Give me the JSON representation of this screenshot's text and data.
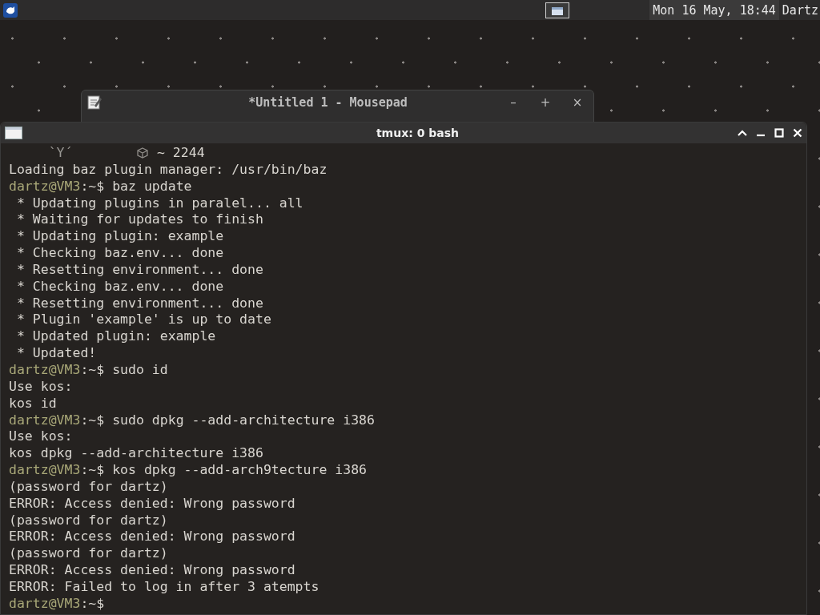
{
  "panel": {
    "clock": "Mon 16 May, 18:44",
    "user": "Dartz"
  },
  "windows": [
    {
      "title": "*Untitled 1 - Mousepad",
      "buttons": [
        "–",
        "+",
        "×"
      ]
    }
  ],
  "terminal": {
    "title": "tmux: 0 bash",
    "lines": [
      {
        "kind": "banner",
        "art": "`Y´",
        "text": "~ 2244"
      },
      {
        "kind": "output",
        "text": "Loading baz plugin manager: /usr/bin/baz"
      },
      {
        "kind": "prompt",
        "user": "dartz@VM3",
        "path": ":~$",
        "command": "baz update"
      },
      {
        "kind": "output",
        "text": " * Updating plugins in paralel... all"
      },
      {
        "kind": "output",
        "text": " * Waiting for updates to finish"
      },
      {
        "kind": "output",
        "text": " * Updating plugin: example"
      },
      {
        "kind": "output",
        "text": " * Checking baz.env... done"
      },
      {
        "kind": "output",
        "text": " * Resetting environment... done"
      },
      {
        "kind": "output",
        "text": " * Checking baz.env... done"
      },
      {
        "kind": "output",
        "text": " * Resetting environment... done"
      },
      {
        "kind": "output",
        "text": " * Plugin 'example' is up to date"
      },
      {
        "kind": "output",
        "text": " * Updated plugin: example"
      },
      {
        "kind": "output",
        "text": " * Updated!"
      },
      {
        "kind": "prompt",
        "user": "dartz@VM3",
        "path": ":~$",
        "command": "sudo id"
      },
      {
        "kind": "output",
        "text": "Use kos:"
      },
      {
        "kind": "output",
        "text": "kos id"
      },
      {
        "kind": "prompt",
        "user": "dartz@VM3",
        "path": ":~$",
        "command": "sudo dpkg --add-architecture i386"
      },
      {
        "kind": "output",
        "text": "Use kos:"
      },
      {
        "kind": "output",
        "text": "kos dpkg --add-architecture i386"
      },
      {
        "kind": "prompt",
        "user": "dartz@VM3",
        "path": ":~$",
        "command": "kos dpkg --add-arch9tecture i386"
      },
      {
        "kind": "output",
        "text": "(password for dartz)"
      },
      {
        "kind": "output",
        "text": "ERROR: Access denied: Wrong password"
      },
      {
        "kind": "output",
        "text": "(password for dartz)"
      },
      {
        "kind": "output",
        "text": "ERROR: Access denied: Wrong password"
      },
      {
        "kind": "output",
        "text": "(password for dartz)"
      },
      {
        "kind": "output",
        "text": "ERROR: Access denied: Wrong password"
      },
      {
        "kind": "output",
        "text": "ERROR: Failed to log in after 3 atempts"
      },
      {
        "kind": "prompt",
        "user": "dartz@VM3",
        "path": ":~$"
      }
    ]
  }
}
